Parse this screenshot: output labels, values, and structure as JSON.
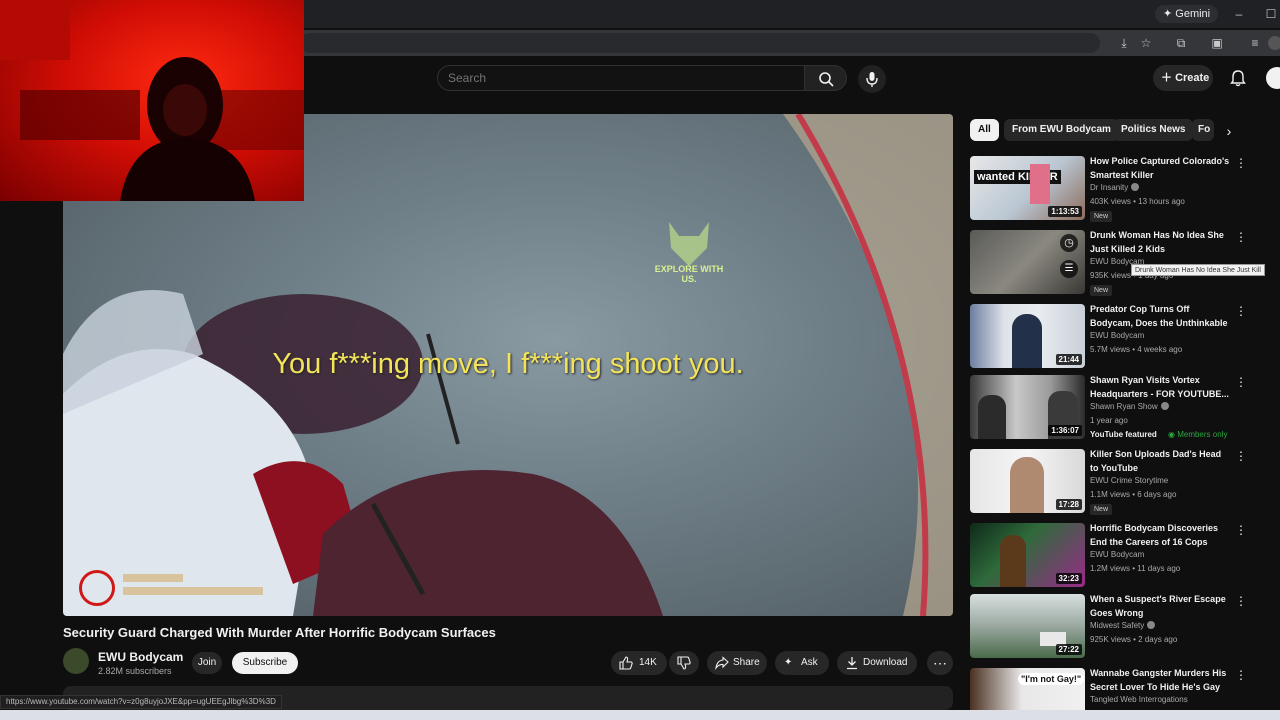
{
  "browser": {
    "gemini_label": "Gemini",
    "window_controls": [
      "–",
      "☐"
    ]
  },
  "header": {
    "search_placeholder": "Search",
    "create_label": "Create"
  },
  "player": {
    "subtitle": "You f***ing move, I f***ing shoot you.",
    "watermark": "EXPLORE WITH US.",
    "status_url": "https://www.youtube.com/watch?v=z0g8uyjoJXE&pp=ugUEEgJlbg%3D%3D"
  },
  "video": {
    "title": "Security Guard Charged With Murder After Horrific Bodycam Surfaces",
    "channel_name": "EWU Bodycam",
    "channel_subs": "2.82M subscribers",
    "join_label": "Join",
    "subscribe_label": "Subscribe",
    "likes": "14K",
    "share_label": "Share",
    "ask_label": "Ask",
    "download_label": "Download"
  },
  "chips": [
    "All",
    "From EWU Bodycam",
    "Politics News",
    "Fo"
  ],
  "recommendations": [
    {
      "title": "How Police Captured Colorado's Smartest Killer",
      "channel": "Dr Insanity",
      "meta": "403K views • 13 hours ago",
      "duration": "1:13:53",
      "badge": "New",
      "thumb_text": "wanted KILLER",
      "verified": true
    },
    {
      "title": "Drunk Woman Has No Idea She Just Killed 2 Kids",
      "channel": "EWU Bodycam",
      "meta": "935K views • 1 day ago",
      "duration": "",
      "badge": "New",
      "tooltip": "Drunk Woman Has No Idea She Just Kill"
    },
    {
      "title": "Predator Cop Turns Off Bodycam, Does the Unthinkable",
      "channel": "EWU Bodycam",
      "meta": "5.7M views • 4 weeks ago",
      "duration": "21:44",
      "badge": ""
    },
    {
      "title": "Shawn Ryan Visits Vortex Headquarters - FOR YOUTUBE...",
      "channel": "Shawn Ryan Show",
      "meta": "1 year ago",
      "duration": "1:36:07",
      "badge": "",
      "featured": "YouTube featured",
      "members": "Members only",
      "verified": true
    },
    {
      "title": "Killer Son Uploads Dad's Head to YouTube",
      "channel": "EWU Crime Storytime",
      "meta": "1.1M views • 6 days ago",
      "duration": "17:28",
      "badge": "New"
    },
    {
      "title": "Horrific Bodycam Discoveries End the Careers of 16 Cops",
      "channel": "EWU Bodycam",
      "meta": "1.2M views • 11 days ago",
      "duration": "32:23",
      "badge": ""
    },
    {
      "title": "When a Suspect's River Escape Goes Wrong",
      "channel": "Midwest Safety",
      "meta": "925K views • 2 days ago",
      "duration": "27:22",
      "badge": "",
      "verified": true
    },
    {
      "title": "Wannabe Gangster Murders His Secret Lover To Hide He's Gay",
      "channel": "Tangled Web Interrogations",
      "meta": "",
      "duration": "",
      "badge": "",
      "thumb_text": "\"I'm not Gay!\""
    }
  ],
  "colors": {
    "accent_red": "#ff0000",
    "subtitle_yellow": "#f2e35a",
    "members_green": "#2ba640"
  }
}
